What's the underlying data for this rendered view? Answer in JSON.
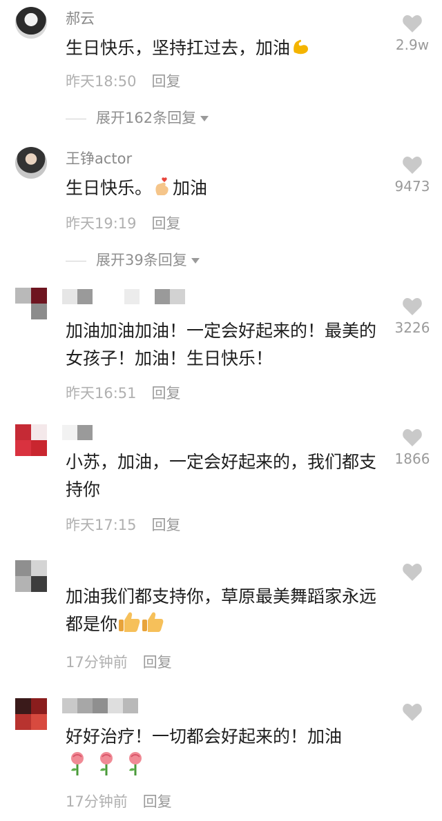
{
  "comments": [
    {
      "username": "郝云",
      "text": "生日快乐，坚持扛过去，加油",
      "text_emoji": "flexed-biceps",
      "time": "昨天18:50",
      "reply_label": "回复",
      "expand_label": "展开162条回复",
      "likes": "2.9w"
    },
    {
      "username": "王铮actor",
      "text": "生日快乐。",
      "text_emoji": "finger-heart",
      "text_after": "加油",
      "time": "昨天19:19",
      "reply_label": "回复",
      "expand_label": "展开39条回复",
      "likes": "9473"
    },
    {
      "text": "加油加油加油！一定会好起来的！最美的女孩子！加油！生日快乐！",
      "time": "昨天16:51",
      "reply_label": "回复",
      "likes": "3226"
    },
    {
      "text": "小苏，加油，一定会好起来的，我们都支持你",
      "time": "昨天17:15",
      "reply_label": "回复",
      "likes": "1866"
    },
    {
      "text": "加油我们都支持你，草原最美舞蹈家永远都是你",
      "text_emoji": "thumbs-up x2",
      "time": "17分钟前",
      "reply_label": "回复",
      "likes": ""
    },
    {
      "text": "好好治疗！一切都会好起来的！加油",
      "text_emoji": "rose x3",
      "time": "17分钟前",
      "reply_label": "回复",
      "likes": ""
    }
  ],
  "colors": {
    "username": "#8a8a8a",
    "meta": "#b0b0b0",
    "heart": "#c9c9c9"
  }
}
